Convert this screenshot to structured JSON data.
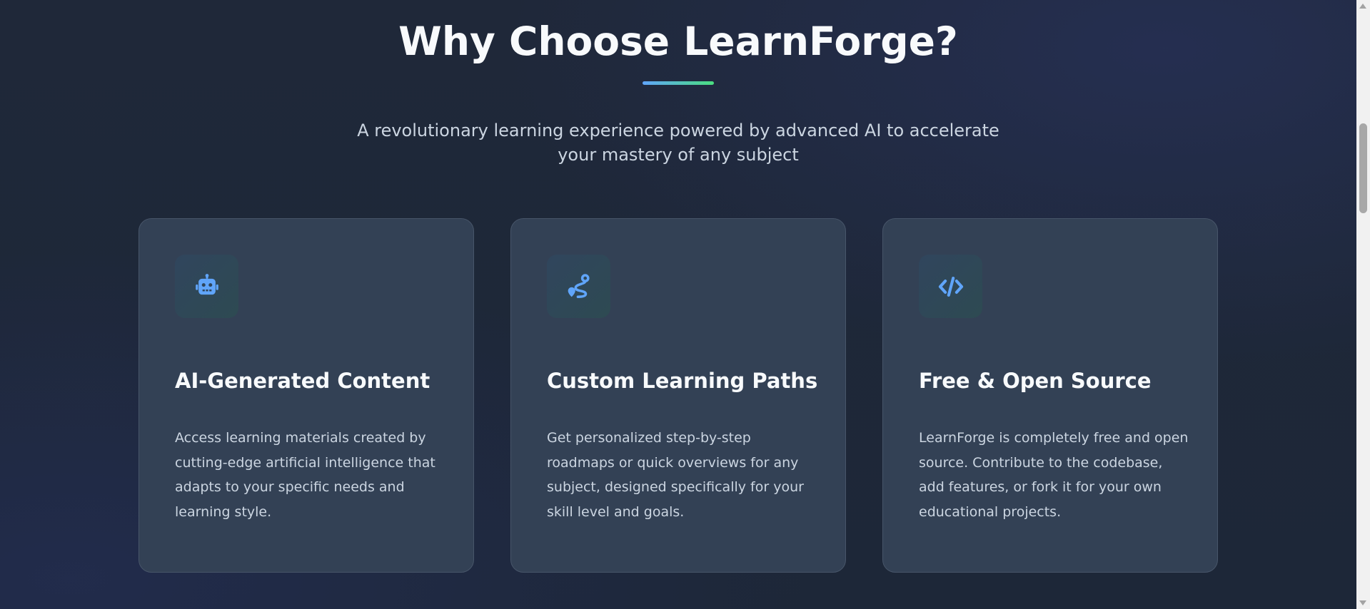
{
  "section": {
    "title": "Why Choose LearnForge?",
    "subtitle": "A revolutionary learning experience powered by advanced AI to accelerate your mastery of any subject",
    "accent_gradient": [
      "#60a5fa",
      "#4ade80"
    ]
  },
  "features": [
    {
      "icon": "robot-icon",
      "title": "AI-Generated Content",
      "text": "Access learning materials created by cutting-edge artificial intelligence that adapts to your specific needs and learning style."
    },
    {
      "icon": "route-icon",
      "title": "Custom Learning Paths",
      "text": "Get personalized step-by-step roadmaps or quick overviews for any subject, designed specifically for your skill level and goals."
    },
    {
      "icon": "code-icon",
      "title": "Free & Open Source",
      "text": "LearnForge is completely free and open source. Contribute to the codebase, add features, or fork it for your own educational projects."
    }
  ],
  "colors": {
    "background": "#1e293b",
    "card": "#334155",
    "icon_accent": "#60a5fa",
    "text_muted": "#cbd5e1"
  }
}
